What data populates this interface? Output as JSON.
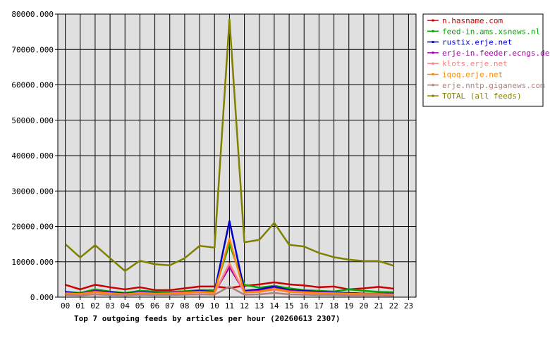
{
  "chart_data": {
    "type": "line",
    "title": "Top 7 outgoing feeds by articles per hour (20260613 2307)",
    "xlabel": "",
    "ylabel": "",
    "grid": true,
    "legend_position": "right",
    "ylim": [
      0,
      80000
    ],
    "y_ticks": [
      "0.000",
      "10000.000",
      "20000.000",
      "30000.000",
      "40000.000",
      "50000.000",
      "60000.000",
      "70000.000",
      "80000.000"
    ],
    "categories": [
      "00",
      "01",
      "02",
      "03",
      "04",
      "05",
      "06",
      "07",
      "08",
      "09",
      "10",
      "11",
      "12",
      "13",
      "14",
      "15",
      "16",
      "17",
      "18",
      "19",
      "20",
      "21",
      "22",
      "23"
    ],
    "series": [
      {
        "name": "n.hasname.com",
        "color": "#cc0000",
        "values": [
          3500,
          2200,
          3500,
          2800,
          2200,
          2800,
          2000,
          2000,
          2500,
          3000,
          3000,
          2600,
          3200,
          3600,
          4200,
          3600,
          3300,
          2800,
          3000,
          2200,
          2500,
          2900,
          2400
        ]
      },
      {
        "name": "feed-in.ams.xsnews.nl",
        "color": "#00aa00",
        "values": [
          1500,
          1200,
          2200,
          1600,
          1200,
          1800,
          1600,
          1500,
          1700,
          2000,
          2000,
          15000,
          3500,
          2700,
          3200,
          2500,
          2000,
          1800,
          1600,
          2200,
          1800,
          1500,
          1400
        ]
      },
      {
        "name": "rustix.erje.net",
        "color": "#0000cc",
        "values": [
          1500,
          1000,
          1800,
          1400,
          1000,
          1400,
          1200,
          1200,
          1500,
          1800,
          1500,
          21500,
          1800,
          2200,
          3000,
          2000,
          1800,
          1500,
          1300,
          1200,
          1000,
          1000,
          1000
        ]
      },
      {
        "name": "erje-in.feeder.ecngs.de",
        "color": "#aa00aa",
        "values": [
          1200,
          1000,
          1700,
          1200,
          900,
          1300,
          1100,
          1200,
          1500,
          1600,
          1400,
          8500,
          1500,
          1800,
          2500,
          1800,
          1500,
          1300,
          1200,
          1000,
          900,
          900,
          800
        ]
      },
      {
        "name": "klots.erje.net",
        "color": "#ff7f7f",
        "values": [
          1000,
          800,
          1400,
          1000,
          800,
          1100,
          900,
          1000,
          1200,
          1400,
          1200,
          9500,
          1300,
          1500,
          2100,
          1500,
          1300,
          1100,
          1000,
          900,
          800,
          800,
          700
        ]
      },
      {
        "name": "iqoq.erje.net",
        "color": "#ff8800",
        "values": [
          1100,
          900,
          1500,
          1100,
          800,
          1200,
          1000,
          1100,
          1300,
          1500,
          1300,
          16500,
          1400,
          1600,
          2400,
          1600,
          1400,
          1200,
          1100,
          1000,
          900,
          900,
          800
        ]
      },
      {
        "name": "erje.nntp.giganews.com",
        "color": "#b08080",
        "values": [
          600,
          500,
          800,
          600,
          500,
          700,
          600,
          600,
          700,
          800,
          700,
          3000,
          700,
          800,
          1200,
          800,
          700,
          600,
          600,
          500,
          500,
          500,
          400
        ]
      },
      {
        "name": "TOTAL (all feeds)",
        "color": "#808000",
        "values": [
          15000,
          11200,
          14700,
          11000,
          7400,
          10300,
          9300,
          9000,
          11000,
          14500,
          14000,
          78500,
          15500,
          16200,
          21000,
          14800,
          14300,
          12500,
          11300,
          10600,
          10200,
          10200,
          8900
        ]
      }
    ]
  }
}
